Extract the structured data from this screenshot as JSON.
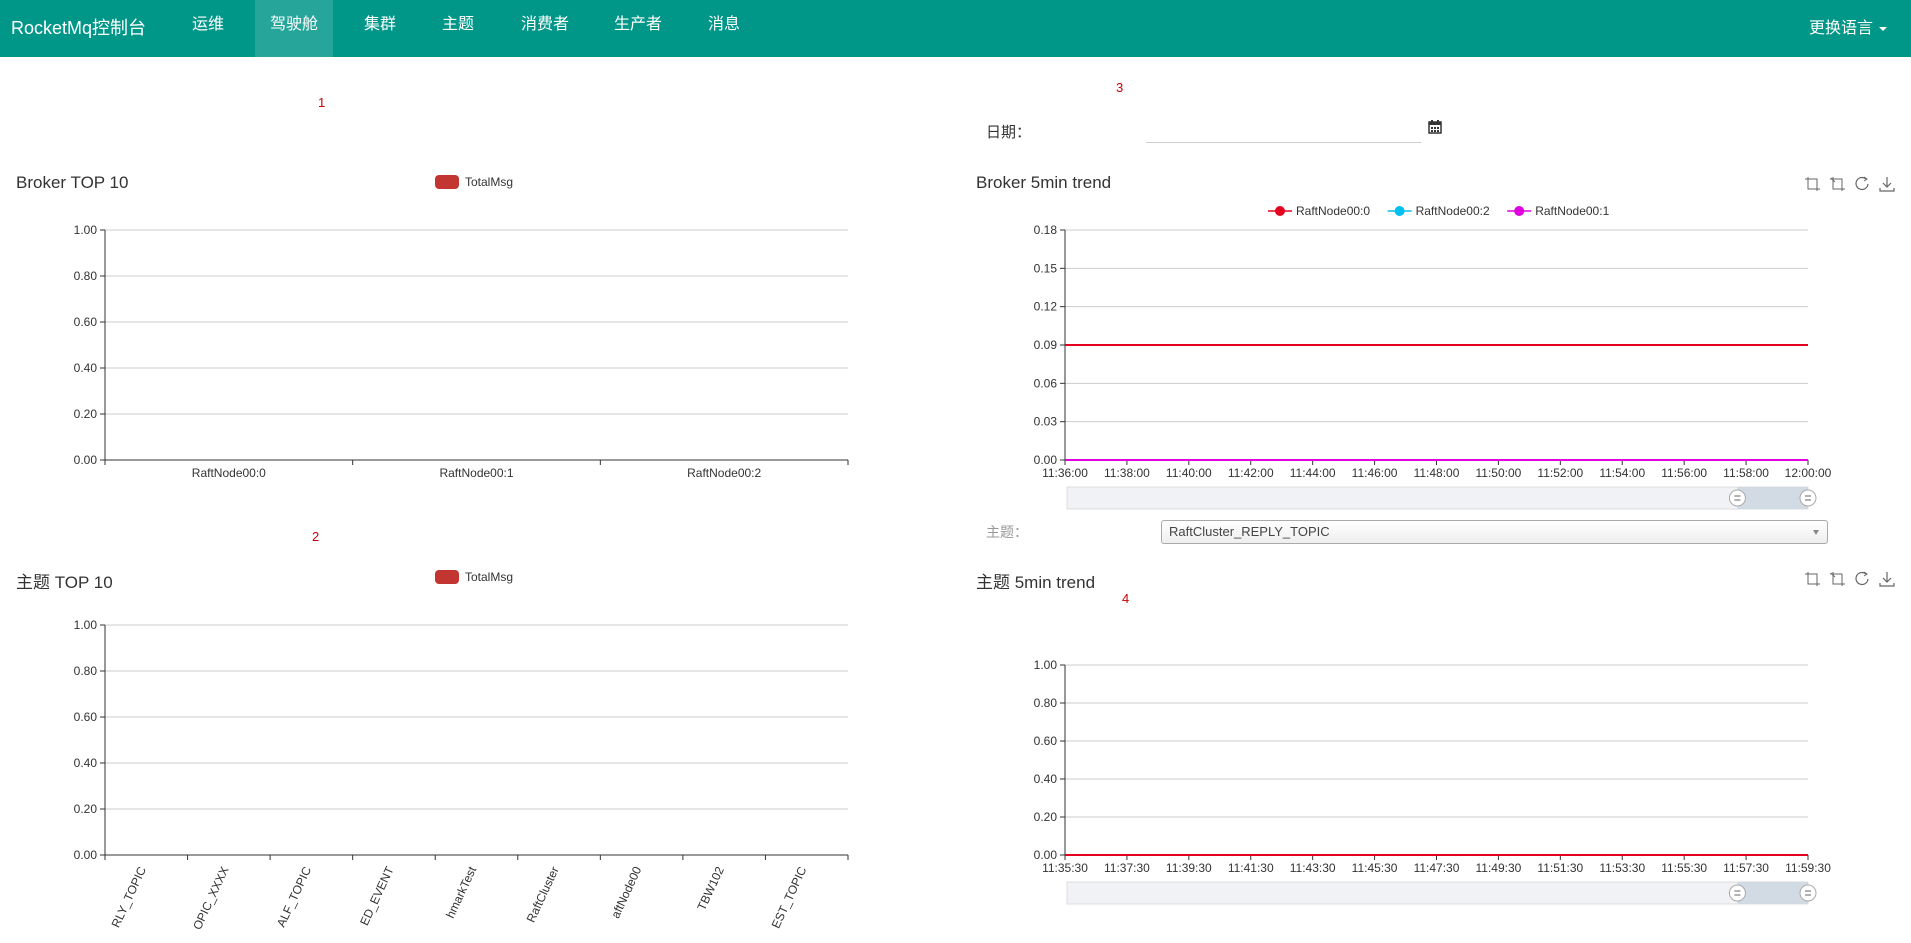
{
  "nav": {
    "brand": "RocketMq控制台",
    "items": [
      "运维",
      "驾驶舱",
      "集群",
      "主题",
      "消费者",
      "生产者",
      "消息"
    ],
    "active_index": 1,
    "language_label": "更换语言"
  },
  "markers": [
    "1",
    "2",
    "3",
    "4"
  ],
  "date": {
    "label": "日期：",
    "value": ""
  },
  "topic_select": {
    "label": "主题：",
    "selected": "RaftCluster_REPLY_TOPIC"
  },
  "icons": {
    "toolbox": [
      "zoom-icon",
      "zoom-reset-icon",
      "restore-icon",
      "save-image-icon"
    ],
    "calendar": "calendar-icon"
  },
  "colors": {
    "navbar": "#009688",
    "bar": "#c23531",
    "series": [
      "#e6001f",
      "#00c0f0",
      "#e000e0"
    ]
  },
  "chart_data": [
    {
      "type": "bar",
      "title": "Broker TOP 10",
      "legend": [
        "TotalMsg"
      ],
      "categories": [
        "RaftNode00:0",
        "RaftNode00:1",
        "RaftNode00:2"
      ],
      "values": [
        0,
        0,
        0
      ],
      "yticks": [
        "0.00",
        "0.20",
        "0.40",
        "0.60",
        "0.80",
        "1.00"
      ],
      "ylim": [
        0,
        1
      ]
    },
    {
      "type": "bar",
      "title": "主题 TOP 10",
      "legend": [
        "TotalMsg"
      ],
      "categories": [
        "RLY_TOPIC",
        "OPIC_XXXX",
        "ALF_TOPIC",
        "ED_EVENT",
        "hmarkTest",
        "RaftCluster",
        "aftNode00",
        "TBW102",
        "EST_TOPIC"
      ],
      "values": [
        0,
        0,
        0,
        0,
        0,
        0,
        0,
        0,
        0
      ],
      "yticks": [
        "0.00",
        "0.20",
        "0.40",
        "0.60",
        "0.80",
        "1.00"
      ],
      "ylim": [
        0,
        1
      ]
    },
    {
      "type": "line",
      "title": "Broker 5min trend",
      "legend": [
        "RaftNode00:0",
        "RaftNode00:2",
        "RaftNode00:1"
      ],
      "x": [
        "11:36:00",
        "11:38:00",
        "11:40:00",
        "11:42:00",
        "11:44:00",
        "11:46:00",
        "11:48:00",
        "11:50:00",
        "11:52:00",
        "11:54:00",
        "11:56:00",
        "11:58:00",
        "12:00:00"
      ],
      "series": [
        {
          "name": "RaftNode00:0",
          "values": [
            0.09,
            0.09,
            0.09,
            0.09,
            0.09,
            0.09,
            0.09,
            0.09,
            0.09,
            0.09,
            0.09,
            0.09,
            0.09
          ]
        },
        {
          "name": "RaftNode00:2",
          "values": [
            0,
            0,
            0,
            0,
            0,
            0,
            0,
            0,
            0,
            0,
            0,
            0,
            0
          ]
        },
        {
          "name": "RaftNode00:1",
          "values": [
            0,
            0,
            0,
            0,
            0,
            0,
            0,
            0,
            0,
            0,
            0,
            0,
            0
          ]
        }
      ],
      "yticks": [
        "0.00",
        "0.03",
        "0.06",
        "0.09",
        "0.12",
        "0.15",
        "0.18"
      ],
      "ylim": [
        0,
        0.18
      ],
      "datazoom": true
    },
    {
      "type": "line",
      "title": "主题 5min trend",
      "legend": [],
      "x": [
        "11:35:30",
        "11:37:30",
        "11:39:30",
        "11:41:30",
        "11:43:30",
        "11:45:30",
        "11:47:30",
        "11:49:30",
        "11:51:30",
        "11:53:30",
        "11:55:30",
        "11:57:30",
        "11:59:30"
      ],
      "series": [
        {
          "values": [
            0,
            0,
            0,
            0,
            0,
            0,
            0,
            0,
            0,
            0,
            0,
            0,
            0
          ]
        }
      ],
      "yticks": [
        "0.00",
        "0.20",
        "0.40",
        "0.60",
        "0.80",
        "1.00"
      ],
      "ylim": [
        0,
        1
      ],
      "datazoom": true
    }
  ]
}
